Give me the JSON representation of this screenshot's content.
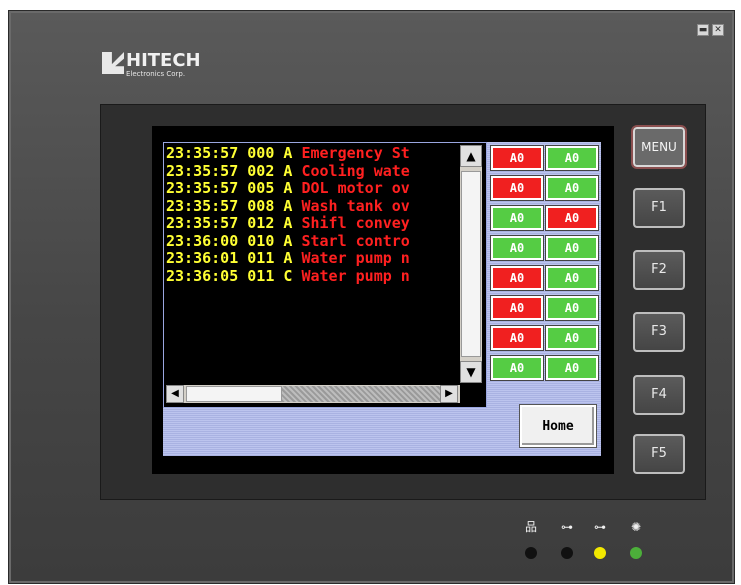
{
  "brand": {
    "name": "HITECH",
    "subtitle": "Electronics Corp."
  },
  "window_controls": {
    "minimize": "▬",
    "close": "✕"
  },
  "alarms": [
    {
      "time": "23:35:57",
      "code": "000",
      "state": "A",
      "text": "Emergency St"
    },
    {
      "time": "23:35:57",
      "code": "002",
      "state": "A",
      "text": "Cooling wate"
    },
    {
      "time": "23:35:57",
      "code": "005",
      "state": "A",
      "text": "DOL motor ov"
    },
    {
      "time": "23:35:57",
      "code": "008",
      "state": "A",
      "text": "Wash tank ov"
    },
    {
      "time": "23:35:57",
      "code": "012",
      "state": "A",
      "text": "Shifl convey"
    },
    {
      "time": "23:36:00",
      "code": "010",
      "state": "A",
      "text": "Starl contro"
    },
    {
      "time": "23:36:01",
      "code": "011",
      "state": "A",
      "text": "Water pump n"
    },
    {
      "time": "23:36:05",
      "code": "011",
      "state": "C",
      "text": "Water pump n"
    }
  ],
  "scrollbar": {
    "up": "▲",
    "down": "▼",
    "left": "◀",
    "right": "▶"
  },
  "indicators": [
    [
      "A0",
      "red"
    ],
    [
      "A0",
      "green"
    ],
    [
      "A0",
      "red"
    ],
    [
      "A0",
      "green"
    ],
    [
      "A0",
      "green"
    ],
    [
      "A0",
      "red"
    ],
    [
      "A0",
      "green"
    ],
    [
      "A0",
      "green"
    ],
    [
      "A0",
      "red"
    ],
    [
      "A0",
      "green"
    ],
    [
      "A0",
      "red"
    ],
    [
      "A0",
      "green"
    ],
    [
      "A0",
      "red"
    ],
    [
      "A0",
      "green"
    ],
    [
      "A0",
      "green"
    ],
    [
      "A0",
      "green"
    ]
  ],
  "home_button": "Home",
  "function_keys": [
    "MENU",
    "F1",
    "F2",
    "F3",
    "F4",
    "F5"
  ],
  "status_leds": [
    {
      "icon": "network-icon",
      "glyph": "品",
      "color": "#111111"
    },
    {
      "icon": "key-icon",
      "glyph": "⊶",
      "color": "#111111"
    },
    {
      "icon": "key-icon",
      "glyph": "⊶",
      "color": "#f2e800"
    },
    {
      "icon": "power-light-icon",
      "glyph": "✺",
      "color": "#4caf3a"
    }
  ]
}
